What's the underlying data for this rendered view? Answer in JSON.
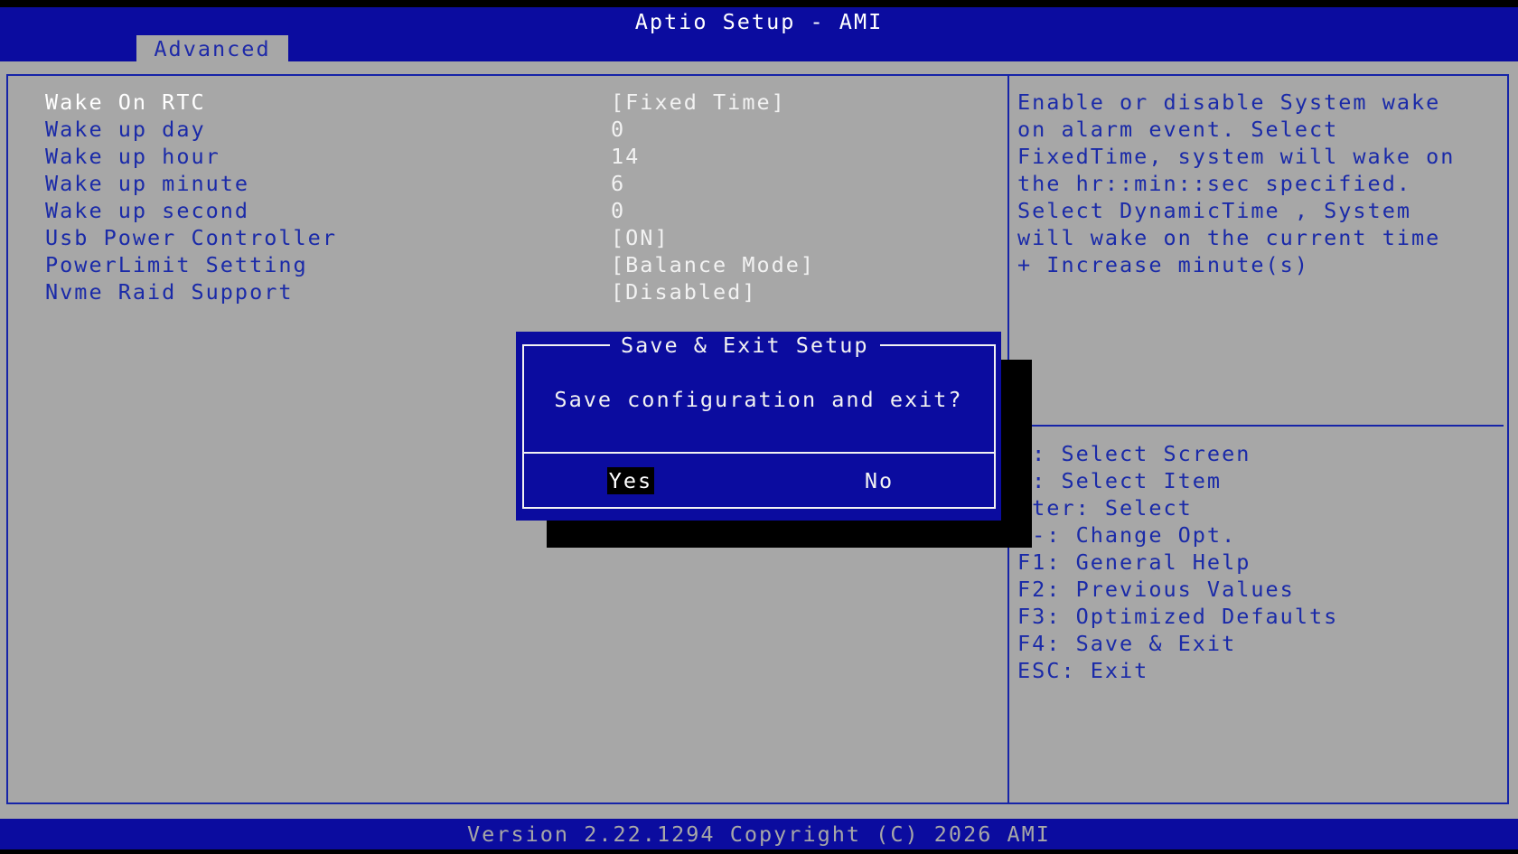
{
  "window": {
    "title": "Aptio Setup - AMI",
    "tab_label": "Advanced"
  },
  "settings": [
    {
      "label": "Wake On RTC",
      "value": "[Fixed Time]"
    },
    {
      "label": "Wake up day",
      "value": "0"
    },
    {
      "label": "Wake up hour",
      "value": "14"
    },
    {
      "label": "Wake up minute",
      "value": "6"
    },
    {
      "label": "Wake up second",
      "value": "0"
    },
    {
      "label": "Usb Power Controller",
      "value": "[ON]"
    },
    {
      "label": "PowerLimit Setting",
      "value": "[Balance Mode]"
    },
    {
      "label": "Nvme Raid Support",
      "value": "[Disabled]"
    }
  ],
  "help": {
    "lines": [
      "Enable or disable System wake",
      "on alarm event. Select",
      "FixedTime, system will wake on",
      "the hr::min::sec specified.",
      "Select DynamicTime , System",
      "will wake on the current time",
      "+ Increase minute(s)"
    ]
  },
  "keys": {
    "lines": [
      "←: Select Screen",
      "↓: Select Item",
      "nter: Select",
      "/-: Change Opt.",
      "F1: General Help",
      "F2: Previous Values",
      "F3: Optimized Defaults",
      "F4: Save & Exit",
      "ESC: Exit"
    ]
  },
  "dialog": {
    "title": "Save & Exit Setup",
    "message": "Save configuration and exit?",
    "yes_label": "Yes",
    "no_label": "No"
  },
  "footer": {
    "version": "Version 2.22.1294 Copyright (C) 2026 AMI"
  },
  "colors": {
    "bios_blue": "#0b0c9f",
    "panel_gray": "#a7a7a7",
    "text_white": "#f2f2f2",
    "text_blue": "#1a2aa8"
  }
}
